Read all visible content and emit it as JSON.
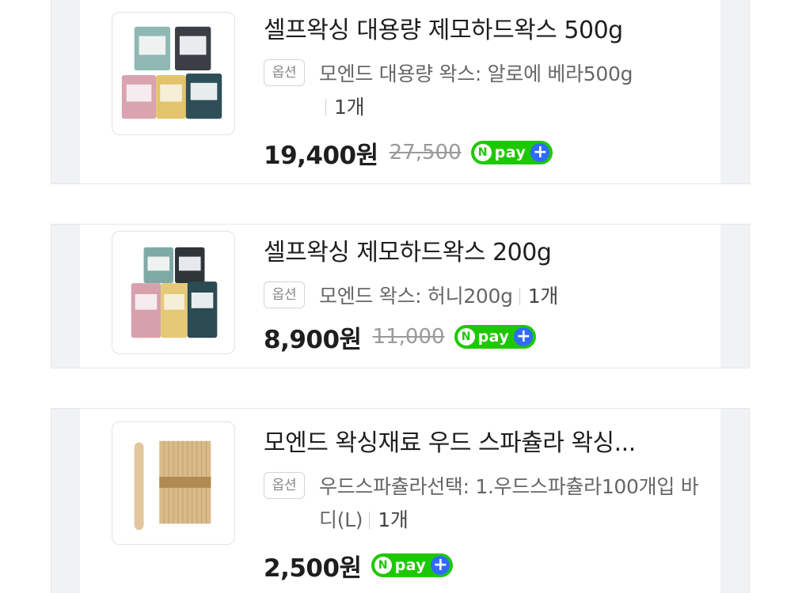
{
  "items": [
    {
      "title": "셀프왁싱 대용량 제모하드왁스 500g",
      "option_tag": "옵션",
      "option_text": "모엔드 대용량 왁스: 알로에 베라500g",
      "quantity": "1개",
      "price": "19,400원",
      "original_price": "27,500",
      "pay_badge": "pay",
      "pay_badge_n": "N",
      "pay_badge_plus": "+",
      "thumbnail": "wax-beads-5-bags-icon"
    },
    {
      "title": "셀프왁싱 제모하드왁스 200g",
      "option_tag": "옵션",
      "option_text": "모엔드 왁스: 허니200g",
      "quantity": "1개",
      "price": "8,900원",
      "original_price": "11,000",
      "pay_badge": "pay",
      "pay_badge_n": "N",
      "pay_badge_plus": "+",
      "thumbnail": "wax-beads-5-bags-icon"
    },
    {
      "title": "모엔드 왁싱재료 우드 스파츌라 왁싱...",
      "option_tag": "옵션",
      "option_text": "우드스파츌라선택: 1.우드스파츌라100개입 바디(L)",
      "quantity": "1개",
      "price": "2,500원",
      "pay_badge": "pay",
      "pay_badge_n": "N",
      "pay_badge_plus": "+",
      "thumbnail": "wooden-spatula-bundle-icon"
    }
  ],
  "colors": {
    "npay_green": "#1ec800",
    "npay_plus_blue": "#2f6bff",
    "price_text": "#1e1e1e",
    "strike_text": "#9a9a9a"
  }
}
